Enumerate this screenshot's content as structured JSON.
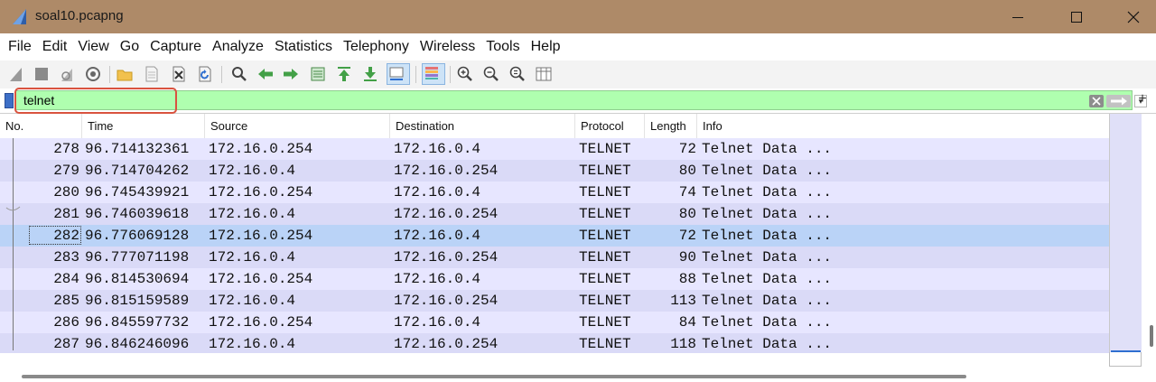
{
  "window": {
    "title": "soal10.pcapng",
    "icon": "wireshark-fin-icon"
  },
  "menu": [
    "File",
    "Edit",
    "View",
    "Go",
    "Capture",
    "Analyze",
    "Statistics",
    "Telephony",
    "Wireless",
    "Tools",
    "Help"
  ],
  "toolbar": {
    "icons": [
      "start-capture-icon",
      "stop-capture-icon",
      "restart-capture-icon",
      "capture-options-icon",
      "open-file-icon",
      "save-file-icon",
      "close-file-icon",
      "reload-file-icon",
      "find-packet-icon",
      "go-back-icon",
      "go-forward-icon",
      "go-to-packet-icon",
      "go-first-icon",
      "go-last-icon",
      "auto-scroll-icon",
      "colorize-icon",
      "zoom-in-icon",
      "zoom-out-icon",
      "normal-size-icon",
      "resize-columns-icon"
    ]
  },
  "filter": {
    "value": "telnet",
    "plus": "+",
    "colors": {
      "valid_bg": "#afffaf",
      "highlight": "#d9533f"
    }
  },
  "columns": [
    "No.",
    "Time",
    "Source",
    "Destination",
    "Protocol",
    "Length",
    "Info"
  ],
  "packets": [
    {
      "no": "278",
      "time": "96.714132361",
      "src": "172.16.0.254",
      "dst": "172.16.0.4",
      "proto": "TELNET",
      "len": "72",
      "info": "Telnet Data ..."
    },
    {
      "no": "279",
      "time": "96.714704262",
      "src": "172.16.0.4",
      "dst": "172.16.0.254",
      "proto": "TELNET",
      "len": "80",
      "info": "Telnet Data ..."
    },
    {
      "no": "280",
      "time": "96.745439921",
      "src": "172.16.0.254",
      "dst": "172.16.0.4",
      "proto": "TELNET",
      "len": "74",
      "info": "Telnet Data ..."
    },
    {
      "no": "281",
      "time": "96.746039618",
      "src": "172.16.0.4",
      "dst": "172.16.0.254",
      "proto": "TELNET",
      "len": "80",
      "info": "Telnet Data ..."
    },
    {
      "no": "282",
      "time": "96.776069128",
      "src": "172.16.0.254",
      "dst": "172.16.0.4",
      "proto": "TELNET",
      "len": "72",
      "info": "Telnet Data ..."
    },
    {
      "no": "283",
      "time": "96.777071198",
      "src": "172.16.0.4",
      "dst": "172.16.0.254",
      "proto": "TELNET",
      "len": "90",
      "info": "Telnet Data ..."
    },
    {
      "no": "284",
      "time": "96.814530694",
      "src": "172.16.0.254",
      "dst": "172.16.0.4",
      "proto": "TELNET",
      "len": "88",
      "info": "Telnet Data ..."
    },
    {
      "no": "285",
      "time": "96.815159589",
      "src": "172.16.0.4",
      "dst": "172.16.0.254",
      "proto": "TELNET",
      "len": "113",
      "info": "Telnet Data ..."
    },
    {
      "no": "286",
      "time": "96.845597732",
      "src": "172.16.0.254",
      "dst": "172.16.0.4",
      "proto": "TELNET",
      "len": "84",
      "info": "Telnet Data ..."
    },
    {
      "no": "287",
      "time": "96.846246096",
      "src": "172.16.0.4",
      "dst": "172.16.0.254",
      "proto": "TELNET",
      "len": "118",
      "info": "Telnet Data ..."
    }
  ],
  "selected_packet": "282",
  "colors": {
    "row_bg": "#e7e6ff",
    "row_alt_bg": "#dadaf7",
    "selected_bg": "#bad3f7",
    "title_bar": "#ae8a68"
  }
}
